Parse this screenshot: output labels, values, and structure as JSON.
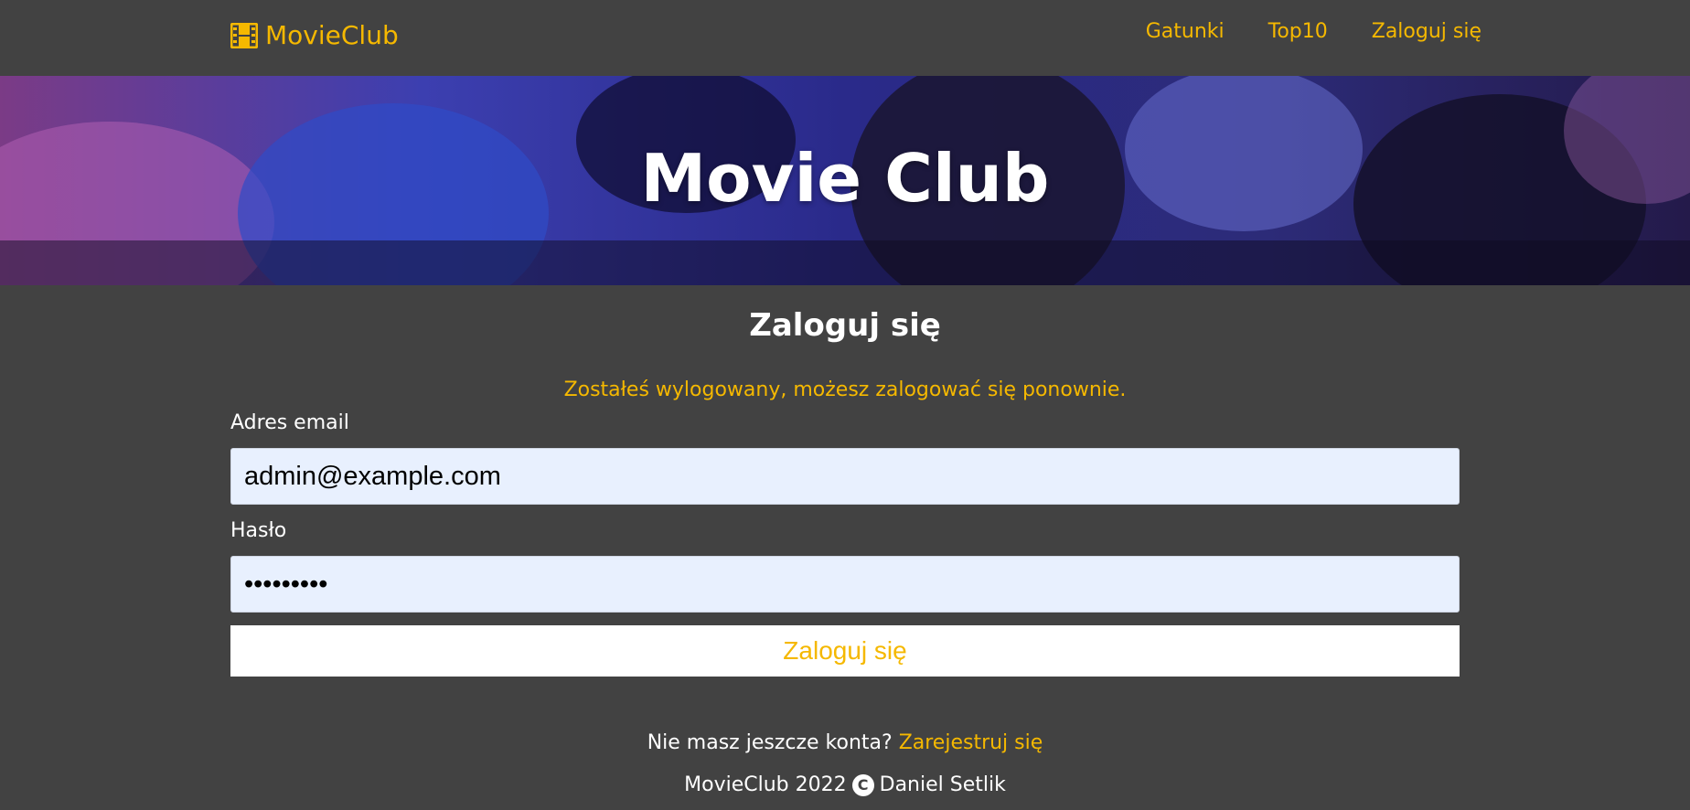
{
  "brand": {
    "name": "MovieClub",
    "icon": "film-icon",
    "color": "#f5b800"
  },
  "nav": [
    {
      "label": "Gatunki"
    },
    {
      "label": "Top10"
    },
    {
      "label": "Zaloguj się"
    }
  ],
  "hero": {
    "title": "Movie Club"
  },
  "login": {
    "title": "Zaloguj się",
    "message": "Zostałeś wylogowany, możesz zalogować się ponownie.",
    "email_label": "Adres email",
    "email_value": "admin@example.com",
    "password_label": "Hasło",
    "password_value": "•••••••••",
    "submit_label": "Zaloguj się"
  },
  "register": {
    "prompt": "Nie masz jeszcze konta?",
    "link_label": "Zarejestruj się"
  },
  "footer": {
    "left": "MovieClub 2022",
    "copyright_icon": "copyright-icon",
    "author": "Daniel Setlik"
  },
  "colors": {
    "accent": "#f5b800",
    "background": "#424242",
    "input_bg": "#e8f0fe"
  }
}
